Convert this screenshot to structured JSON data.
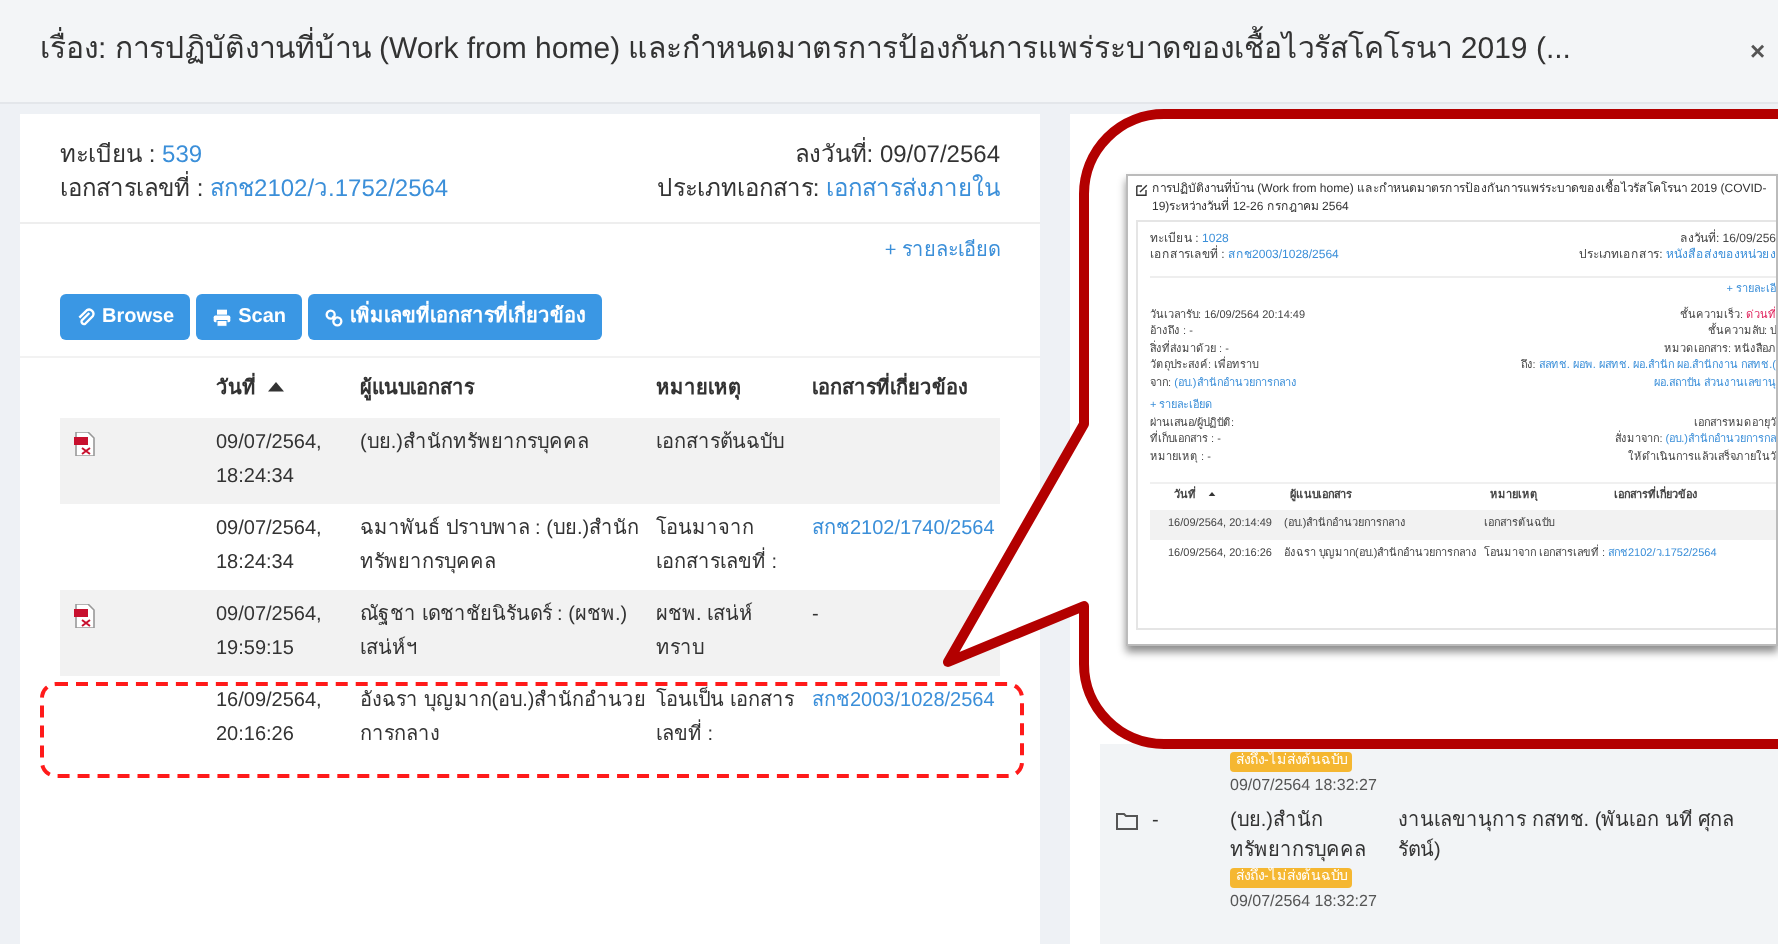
{
  "dialog": {
    "title": "เรื่อง: การปฏิบัติงานที่บ้าน (Work from home) และกำหนดมาตรการป้องกันการแพร่ระบาดของเชื้อไวรัสโคโรนา 2019 (...",
    "close": "×"
  },
  "document": {
    "fields": [
      {
        "label": "ทะเบียน :",
        "value": "539",
        "kind": "link"
      },
      {
        "label": "เอกสารเลขที่ :",
        "value": "สกช2102/ว.1752/2564",
        "kind": "link"
      }
    ],
    "side_fields": [
      {
        "label": "ลงวันที่:",
        "value": "09/07/2564",
        "kind": "plain"
      },
      {
        "label": "ประเภทเอกสาร:",
        "value": "เอกสารส่งภายใน",
        "kind": "link"
      }
    ],
    "details_link": "+ รายละเอียด"
  },
  "toolbar": [
    {
      "kind": "attach",
      "label": "Browse"
    },
    {
      "kind": "print",
      "label": "Scan"
    },
    {
      "kind": "link",
      "label": "เพิ่มเลขที่เอกสารที่เกี่ยวข้อง"
    }
  ],
  "attachments": {
    "columns": [
      {
        "label": "วันที่",
        "sorted": true
      },
      {
        "label": "ผู้แนบเอกสาร",
        "sorted": false
      },
      {
        "label": "หมายเหตุ",
        "sorted": false
      },
      {
        "label": "เอกสารที่เกี่ยวข้อง",
        "sorted": false
      }
    ],
    "rows": [
      {
        "file": true,
        "date": "09/07/2564, 18:24:34",
        "attached_by": "(บย.)สำนักทรัพยากรบุคคล",
        "note": "เอกสารต้นฉบับ",
        "highlighted": false
      },
      {
        "file": false,
        "date": "09/07/2564, 18:24:34",
        "attached_by": "ฉมาพันธ์ ปราบพาล : (บย.)สำนักทรัพยากรบุคคล",
        "note": "โอนมาจาก เอกสารเลขที่ :",
        "related": {
          "text": "สกช2102/1740/2564",
          "kind": "link"
        },
        "highlighted": false
      },
      {
        "file": true,
        "date": "09/07/2564, 19:59:15",
        "attached_by": "ณัฐชา เดชาชัยนิรันดร์ : (ผชพ.) เสน่ห์ฯ",
        "note": "ผชพ. เสน่ห์ ทราบ",
        "related": {
          "text": "-",
          "kind": "plain"
        },
        "highlighted": false
      },
      {
        "file": false,
        "date": "16/09/2564, 20:16:26",
        "attached_by": "อังฉรา บุญมาก(อบ.)สำนักอำนวยการกลาง",
        "note": "โอนเป็น เอกสารเลขที่ :",
        "related": {
          "text": "สกช2003/1028/2564",
          "kind": "link"
        },
        "highlighted": true
      }
    ]
  },
  "distribution": [
    {
      "folder": false,
      "badge": "ส่งถึง-ไม่ส่งต้นฉบับ",
      "time": "09/07/2564 18:32:27"
    },
    {
      "folder": true,
      "marker": "-",
      "sender": "(บย.)สำนัก ทรัพยากรบุคคล",
      "recipient": "งานเลขานุการ กสทช. (พันเอก นที ศุกล รัตน์)",
      "badge": "ส่งถึง-ไม่ส่งต้นฉบับ",
      "time": "09/07/2564 18:32:27"
    }
  ],
  "inset_screenshot": {
    "title": "การปฏิบัติงานที่บ้าน (Work from home) และกำหนดมาตรการป้องกันการแพร่ระบาดของเชื้อไวรัสโคโรนา 2019 (COVID-19)ระหว่างวันที่ 12-26 กรกฎาคม 2564",
    "header_left": [
      {
        "label": "ทะเบียน :",
        "value": "1028",
        "kind": "link"
      },
      {
        "label": "เอกสารเลขที่ :",
        "value": "สกช2003/1028/2564",
        "kind": "link"
      }
    ],
    "header_right": [
      {
        "label": "ลงวันที่:",
        "value": "16/09/256",
        "kind": "plain"
      },
      {
        "label": "ประเภทเอกสาร:",
        "value": "หนังสือส่งของหน่วยง",
        "kind": "link"
      }
    ],
    "details_link": "+ รายละเอี",
    "info_left": [
      {
        "label": "วันเวลารับ:",
        "value": "16/09/2564 20:14:49",
        "kind": "plain"
      },
      {
        "label": "อ้างถึง : -"
      },
      {
        "label": "สิ่งที่ส่งมาด้วย :",
        "value": "-",
        "kind": "plain"
      },
      {
        "label": "วัตถุประสงค์:",
        "value": "เพื่อทราบ",
        "kind": "plain"
      },
      {
        "label": "จาก:",
        "value": "(อบ.)สำนักอำนวยการกลาง",
        "kind": "link"
      }
    ],
    "info_right": [
      {
        "label": "ชั้นความเร็ว:",
        "value": "ด่วนที่",
        "kind": "alert"
      },
      {
        "label": "ชั้นความลับ:",
        "value": "ป",
        "kind": "plain"
      },
      {
        "label": "หมวดเอกสาร:",
        "value": "หนังสือภ",
        "kind": "plain"
      },
      {
        "label": "ถึง:",
        "value": "สลทช. ผอพ. ผสทช. ผอ.สำนัก ผอ.สำนักงาน กสทช.(",
        "kind": "link"
      },
      {
        "value": "ผอ.สถาบัน ส่วนงานเลขานุ",
        "kind": "link"
      }
    ],
    "more_link": "+ รายละเอียด",
    "info_left2": [
      {
        "label": "ผ่านเสนอ/ผู้ปฏิบัติ:"
      },
      {
        "label": "ที่เก็บเอกสาร : -"
      },
      {
        "label": "หมายเหตุ : -"
      }
    ],
    "info_right2": [
      {
        "label": "เอกสารหมดอายุวั"
      },
      {
        "label": "สั่งมาจาก:",
        "value": "(อบ.)สำนักอำนวยการกล",
        "kind": "link"
      },
      {
        "label": "ให้ดำเนินการแล้วเสร็จภายในวั"
      }
    ],
    "table": {
      "columns": [
        {
          "label": "วันที่",
          "sorted": true
        },
        {
          "label": "ผู้แนบเอกสาร",
          "sorted": false
        },
        {
          "label": "หมายเหตุ",
          "sorted": false
        },
        {
          "label": "เอกสารที่เกี่ยวข้อง",
          "sorted": false
        }
      ],
      "rows": [
        {
          "date": "16/09/2564, 20:14:49",
          "attached_by": "(อบ.)สำนักอำนวยการกลาง",
          "note": "เอกสารต้นฉบับ"
        },
        {
          "date": "16/09/2564, 20:16:26",
          "attached_by": "อังฉรา บุญมาก(อบ.)สำนักอำนวยการกลาง",
          "note": "โอนมาจาก เอกสารเลขที่ :",
          "related": "สกช2102/ว.1752/2564"
        }
      ]
    }
  }
}
